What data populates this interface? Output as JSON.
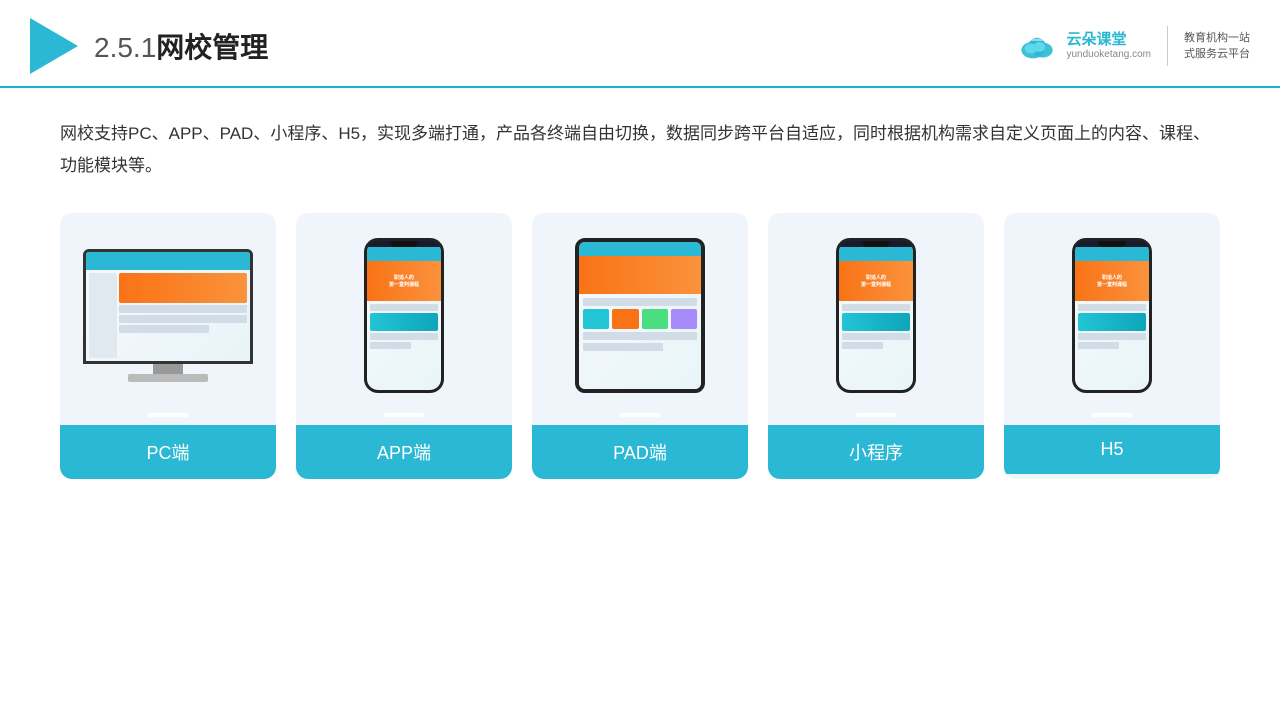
{
  "header": {
    "section_number": "2.5.1",
    "title": "网校管理",
    "brand_name": "云朵课堂",
    "brand_url": "yunduoketang.com",
    "brand_slogan": "教育机构一站\n式服务云平台"
  },
  "description": {
    "text": "网校支持PC、APP、PAD、小程序、H5，实现多端打通，产品各终端自由切换，数据同步跨平台自适应，同时根据机构需求自定义页面上的内容、课程、功能模块等。"
  },
  "cards": [
    {
      "id": "pc",
      "label": "PC端",
      "device": "pc"
    },
    {
      "id": "app",
      "label": "APP端",
      "device": "phone"
    },
    {
      "id": "pad",
      "label": "PAD端",
      "device": "tablet"
    },
    {
      "id": "miniprogram",
      "label": "小程序",
      "device": "phone"
    },
    {
      "id": "h5",
      "label": "H5",
      "device": "phone"
    }
  ]
}
